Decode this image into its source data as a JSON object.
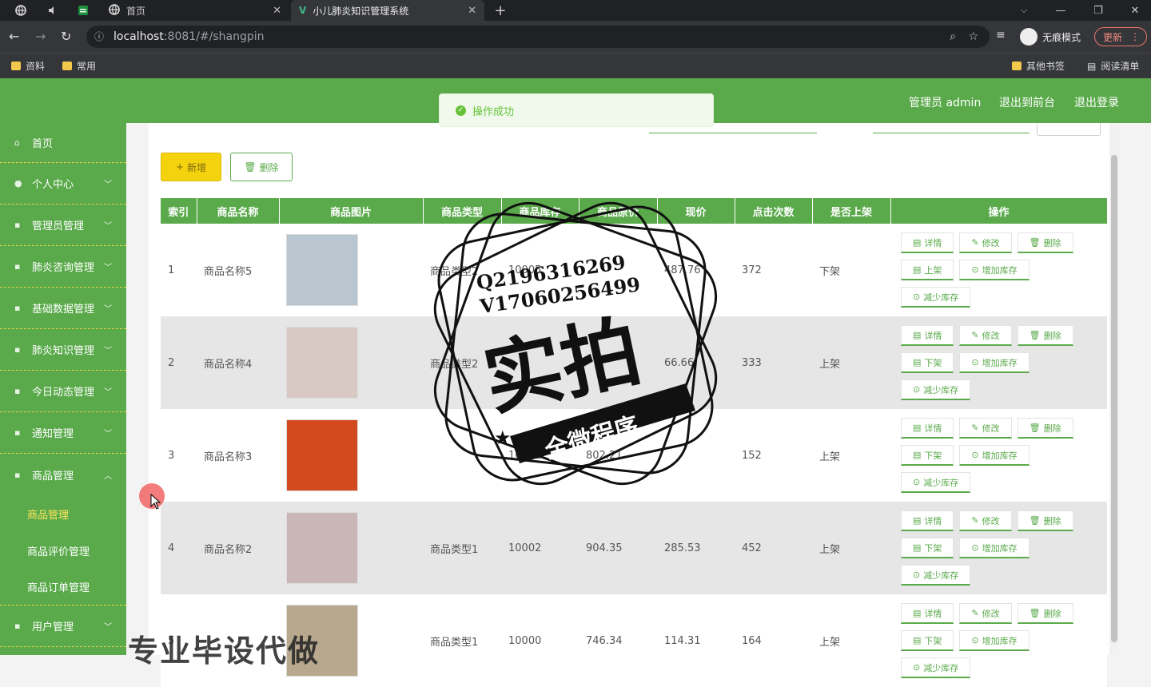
{
  "browser": {
    "tabs": [
      {
        "label": "首页"
      },
      {
        "label": "小儿肺炎知识管理系统"
      }
    ],
    "url_host": "localhost",
    "url_rest": ":8081/#/shangpin",
    "incognito": "无痕模式",
    "update": "更新",
    "bookmarks": [
      {
        "label": "资料"
      },
      {
        "label": "常用"
      }
    ],
    "other_bookmarks": "其他书签",
    "reading_list": "阅读清单"
  },
  "header": {
    "admin": "管理员 admin",
    "to_front": "退出到前台",
    "logout": "退出登录"
  },
  "toast": {
    "message": "操作成功"
  },
  "sidebar": {
    "items": [
      {
        "label": "首页",
        "icon": "home-icon"
      },
      {
        "label": "个人中心",
        "icon": "user-icon"
      },
      {
        "label": "管理员管理",
        "icon": "admin-icon"
      },
      {
        "label": "肺炎咨询管理",
        "icon": "chat-icon"
      },
      {
        "label": "基础数据管理",
        "icon": "data-icon"
      },
      {
        "label": "肺炎知识管理",
        "icon": "book-icon"
      },
      {
        "label": "今日动态管理",
        "icon": "news-icon"
      },
      {
        "label": "通知管理",
        "icon": "bell-icon"
      },
      {
        "label": "商品管理",
        "icon": "goods-icon"
      }
    ],
    "sub_items": [
      {
        "label": "商品管理"
      },
      {
        "label": "商品评价管理"
      },
      {
        "label": "商品订单管理"
      }
    ],
    "last_item": {
      "label": "用户管理",
      "icon": "users-icon"
    }
  },
  "toolbar": {
    "add": "新增",
    "delete": "删除"
  },
  "table": {
    "headers": [
      "索引",
      "商品名称",
      "商品图片",
      "商品类型",
      "商品库存",
      "商品原价",
      "现价",
      "点击次数",
      "是否上架",
      "操作"
    ],
    "rows": [
      {
        "index": "1",
        "name": "商品名称5",
        "type": "商品类型2",
        "stock": "10005",
        "orig": "",
        "price": "487.76",
        "clicks": "372",
        "status": "下架",
        "toggle": "上架",
        "img": "#b9c6cf"
      },
      {
        "index": "2",
        "name": "商品名称4",
        "type": "商品类型2",
        "stock": "",
        "orig": "",
        "price": "66.66",
        "clicks": "333",
        "status": "上架",
        "toggle": "下架",
        "img": "#d9c9c4"
      },
      {
        "index": "3",
        "name": "商品名称3",
        "type": "",
        "stock": "10002",
        "orig": "802.21",
        "price": "",
        "clicks": "152",
        "status": "上架",
        "toggle": "下架",
        "img": "#d24a1e"
      },
      {
        "index": "4",
        "name": "商品名称2",
        "type": "商品类型1",
        "stock": "10002",
        "orig": "904.35",
        "price": "285.53",
        "clicks": "452",
        "status": "上架",
        "toggle": "下架",
        "img": "#c9b7b8"
      },
      {
        "index": "5",
        "name": "",
        "type": "商品类型1",
        "stock": "10000",
        "orig": "746.34",
        "price": "114.31",
        "clicks": "164",
        "status": "上架",
        "toggle": "下架",
        "img": "#b8a98e"
      }
    ],
    "ops": {
      "detail": "详情",
      "edit": "修改",
      "remove": "删除",
      "add_stock": "增加库存",
      "reduce_stock": "减少库存"
    }
  },
  "watermark": {
    "line1": "Q2196316269",
    "line2": "V17060256499",
    "big": "实拍",
    "ribbon": "全微程序",
    "bottom": "专业毕设代做"
  },
  "colors": {
    "brand": "#5aaa4b",
    "accent": "#f5d20e"
  }
}
